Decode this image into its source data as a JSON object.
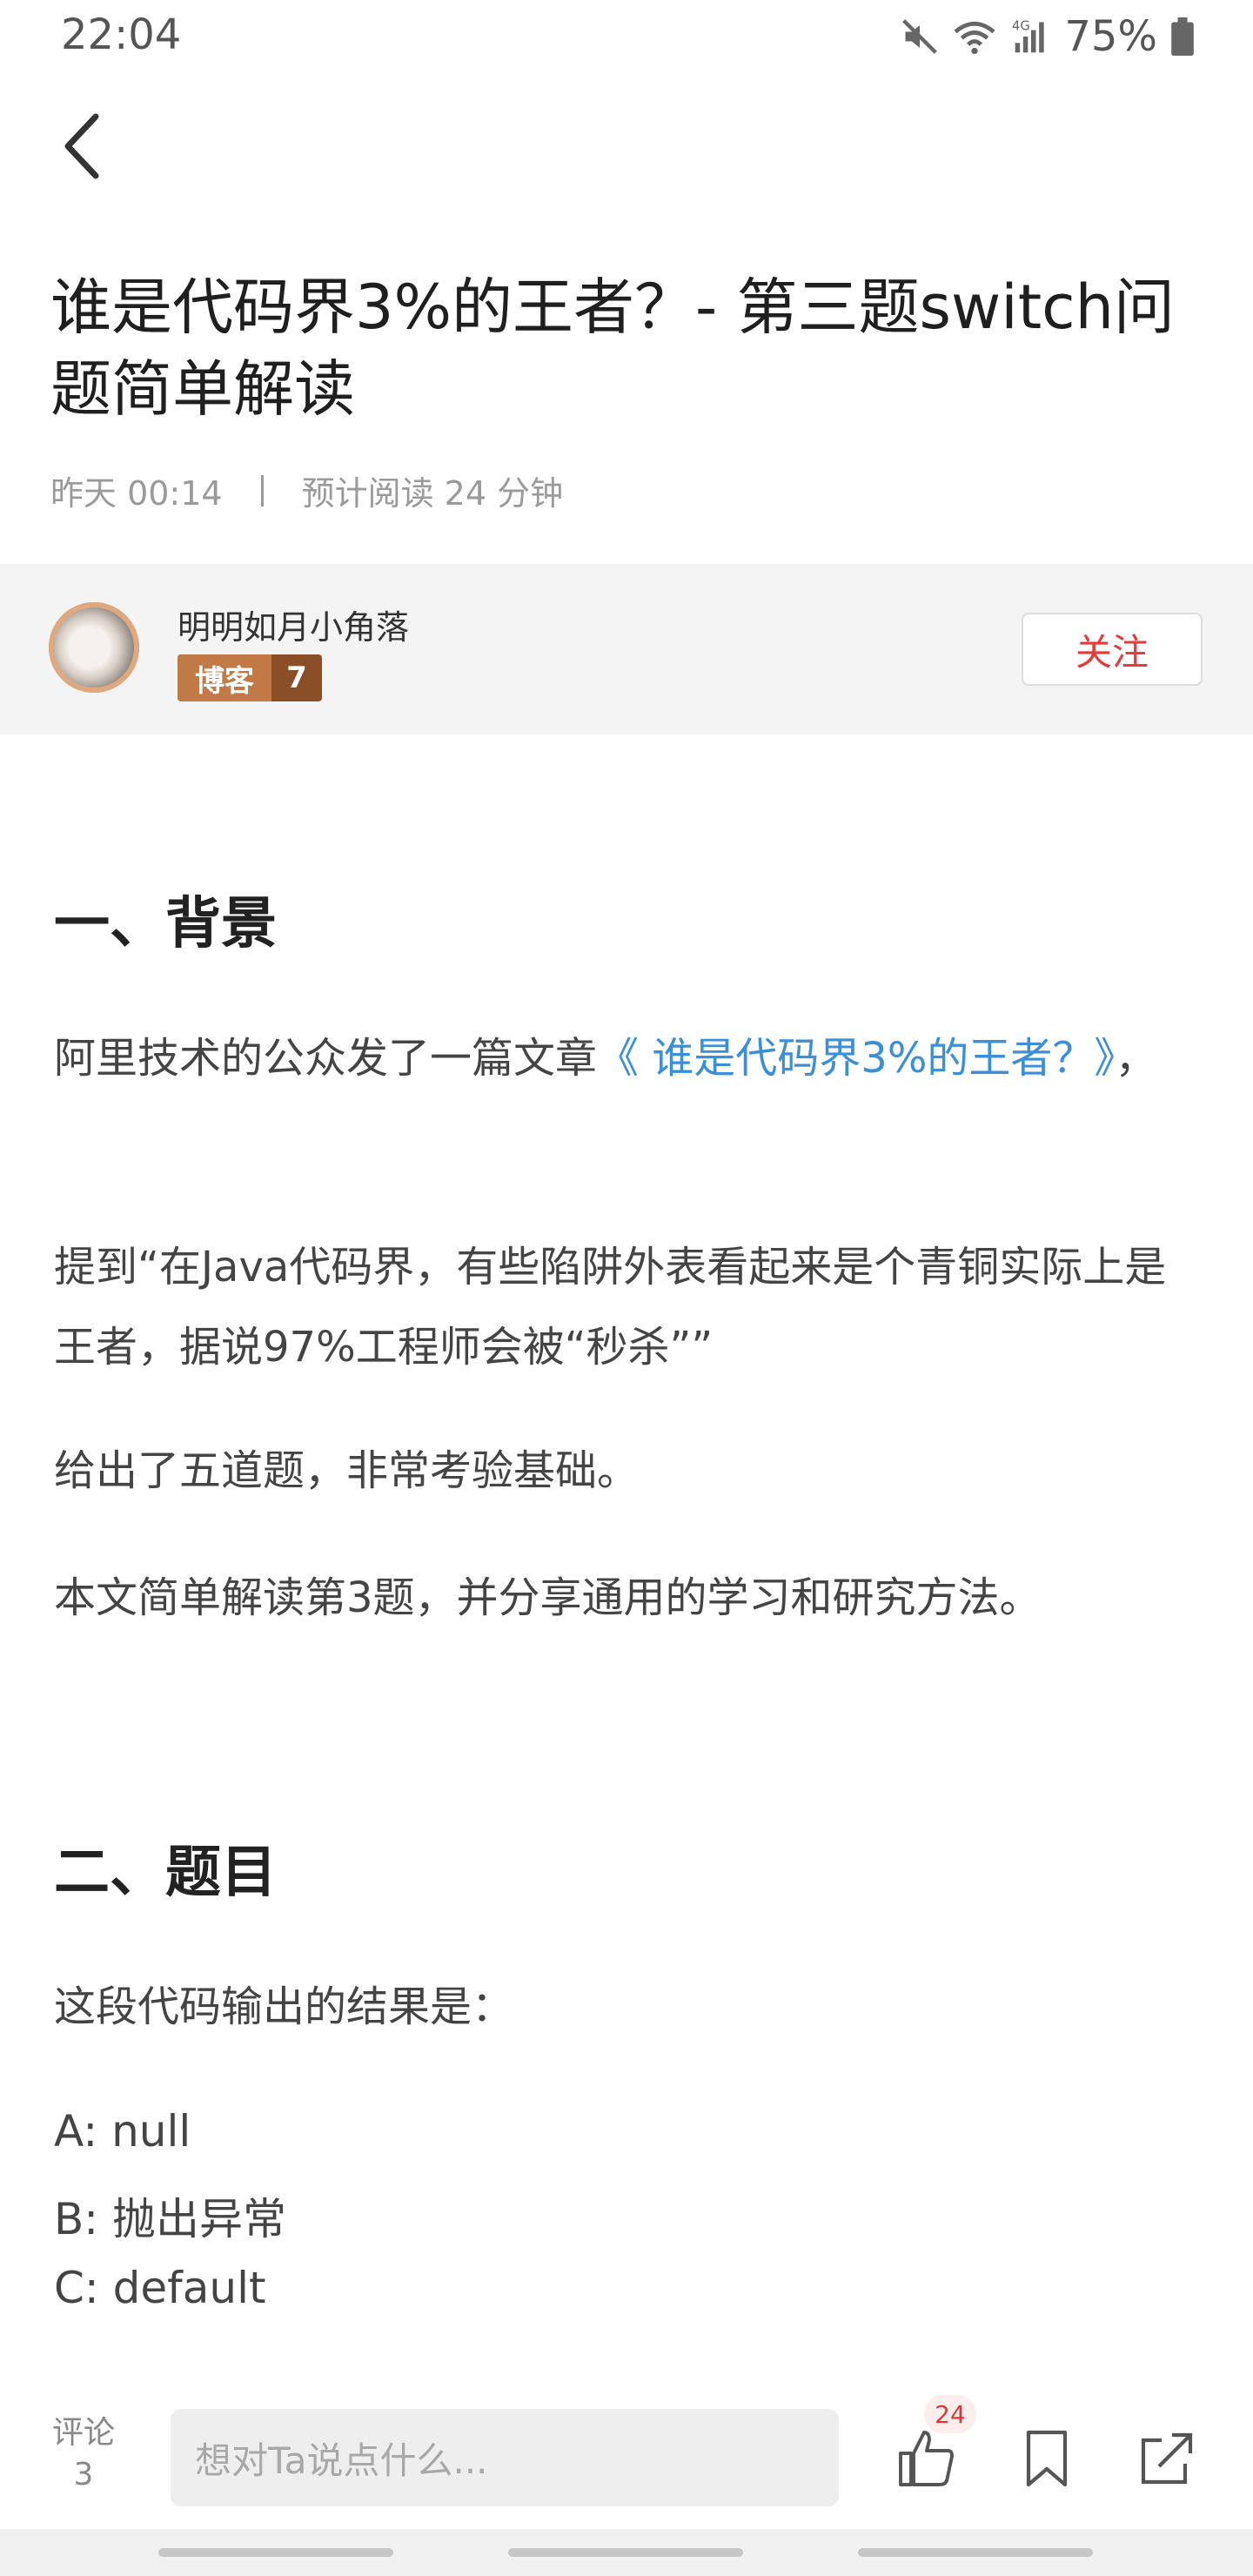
{
  "status_bar": {
    "time": "22:04",
    "battery": "75%",
    "network": "4G"
  },
  "article": {
    "title": "谁是代码界3%的王者？- 第三题switch问题简单解读",
    "date": "昨天 00:14",
    "read_time": "预计阅读 24 分钟"
  },
  "author": {
    "name": "明明如月小角落",
    "badge_label": "博客",
    "badge_level": "7",
    "follow_label": "关注"
  },
  "content": {
    "h1": "一、背景",
    "p1_text": "阿里技术的公众发了一篇文章",
    "p1_link": "《 谁是代码界3%的王者？》",
    "p1_end": "，",
    "p2": "提到“在Java代码界，有些陷阱外表看起来是个青铜实际上是王者，据说97%工程师会被“秒杀””",
    "p3": "给出了五道题，非常考验基础。",
    "p4": "本文简单解读第3题，并分享通用的学习和研究方法。",
    "h2": "二、题目",
    "p5": "这段代码输出的结果是：",
    "options": [
      "A: null",
      "B: 抛出异常",
      "C: default"
    ]
  },
  "bottom_bar": {
    "comment_label": "评论",
    "comment_count": "3",
    "input_placeholder": "想对Ta说点什么...",
    "like_count": "24"
  },
  "colors": {
    "link": "#3b8fd6",
    "follow": "#e53b3b",
    "badge": "#c17a45"
  }
}
